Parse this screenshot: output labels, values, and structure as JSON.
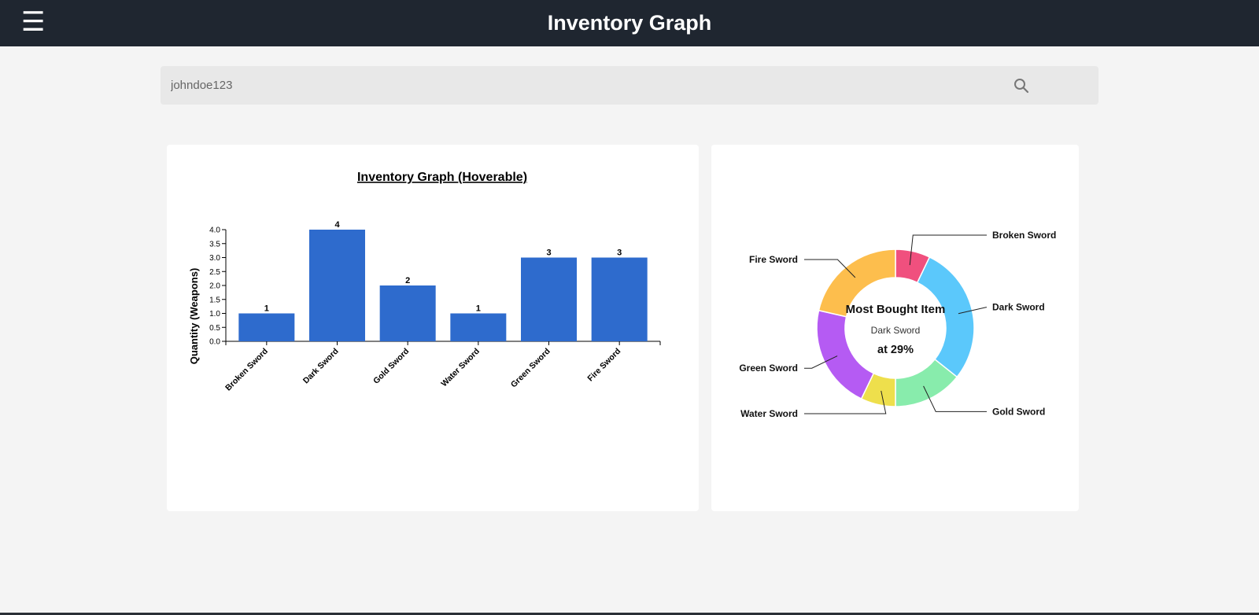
{
  "header": {
    "title": "Inventory Graph",
    "menu_icon": "hamburger-menu-icon"
  },
  "search": {
    "value": "johndoe123",
    "icon": "search-icon"
  },
  "colors": {
    "header_bg": "#1f2630",
    "page_bg": "#f4f4f4",
    "bar": "#2e6bcd"
  },
  "chart_data": [
    {
      "type": "bar",
      "title": "Inventory Graph (Hoverable)",
      "xlabel": "",
      "ylabel": "Quantity (Weapons)",
      "categories": [
        "Broken Sword",
        "Dark Sword",
        "Gold Sword",
        "Water Sword",
        "Green Sword",
        "Fire Sword"
      ],
      "values": [
        1,
        4,
        2,
        1,
        3,
        3
      ],
      "ylim": [
        0,
        4
      ],
      "yticks": [
        "0.0",
        "0.5",
        "1.0",
        "1.5",
        "2.0",
        "2.5",
        "3.0",
        "3.5",
        "4.0"
      ],
      "data_labels": [
        "1",
        "4",
        "2",
        "1",
        "3",
        "3"
      ],
      "grid": false
    },
    {
      "type": "pie",
      "donut": true,
      "center_title": "Most Bought Item",
      "center_item": "Dark Sword",
      "center_value": "at 29%",
      "slices": [
        {
          "label": "Broken Sword",
          "value": 1,
          "color": "#f0507e"
        },
        {
          "label": "Dark Sword",
          "value": 4,
          "color": "#5bc8fb"
        },
        {
          "label": "Gold Sword",
          "value": 2,
          "color": "#88ecac"
        },
        {
          "label": "Water Sword",
          "value": 1,
          "color": "#eedf4c"
        },
        {
          "label": "Green Sword",
          "value": 3,
          "color": "#b55bf3"
        },
        {
          "label": "Fire Sword",
          "value": 3,
          "color": "#fdbe4d"
        }
      ]
    }
  ]
}
